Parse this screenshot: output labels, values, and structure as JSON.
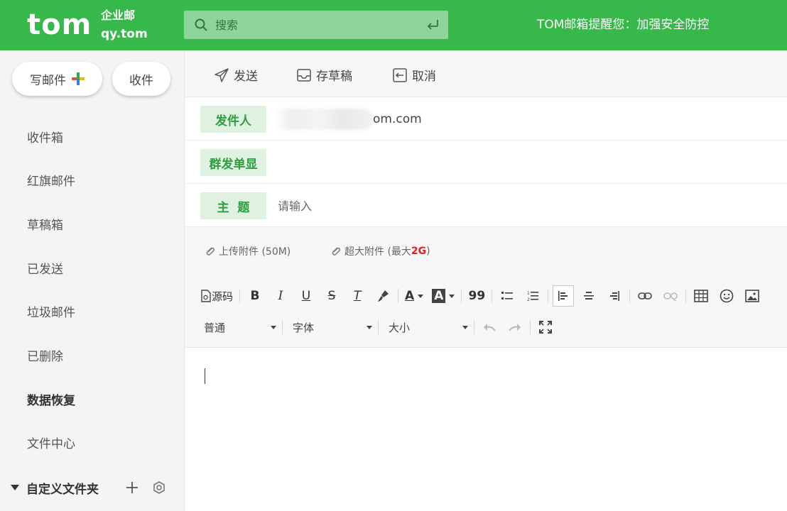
{
  "header": {
    "logo_text": "tom",
    "logo_sub": "企业邮",
    "logo_domain": "qy.tom",
    "search_placeholder": "搜索",
    "notice": "TOM邮箱提醒您：加强安全防控",
    "accent_color": "#36b84a"
  },
  "sidebar": {
    "compose_label": "写邮件",
    "receive_label": "收件",
    "folders": [
      {
        "label": "收件箱"
      },
      {
        "label": "红旗邮件"
      },
      {
        "label": "草稿箱"
      },
      {
        "label": "已发送"
      },
      {
        "label": "垃圾邮件"
      },
      {
        "label": "已删除"
      },
      {
        "label": "数据恢复"
      },
      {
        "label": "文件中心"
      }
    ],
    "custom_folder_label": "自定义文件夹"
  },
  "toolbar": {
    "send_label": "发送",
    "draft_label": "存草稿",
    "cancel_label": "取消"
  },
  "form": {
    "sender_label": "发件人",
    "sender_value": "om.com",
    "group_label": "群发单显",
    "subject_label": "主  题",
    "subject_placeholder": "请输入"
  },
  "attachments": {
    "upload_label": "上传附件 (50M)",
    "large_prefix": "超大附件 (最大 ",
    "large_size": "2G",
    "large_suffix": ")"
  },
  "editor": {
    "source_label": "源码",
    "bold": "B",
    "italic": "I",
    "underline": "U",
    "strike": "S",
    "clear_format": "T",
    "font_color": "A",
    "bg_color": "A",
    "quote": "99",
    "format_value": "普通",
    "font_value": "字体",
    "size_value": "大小"
  }
}
